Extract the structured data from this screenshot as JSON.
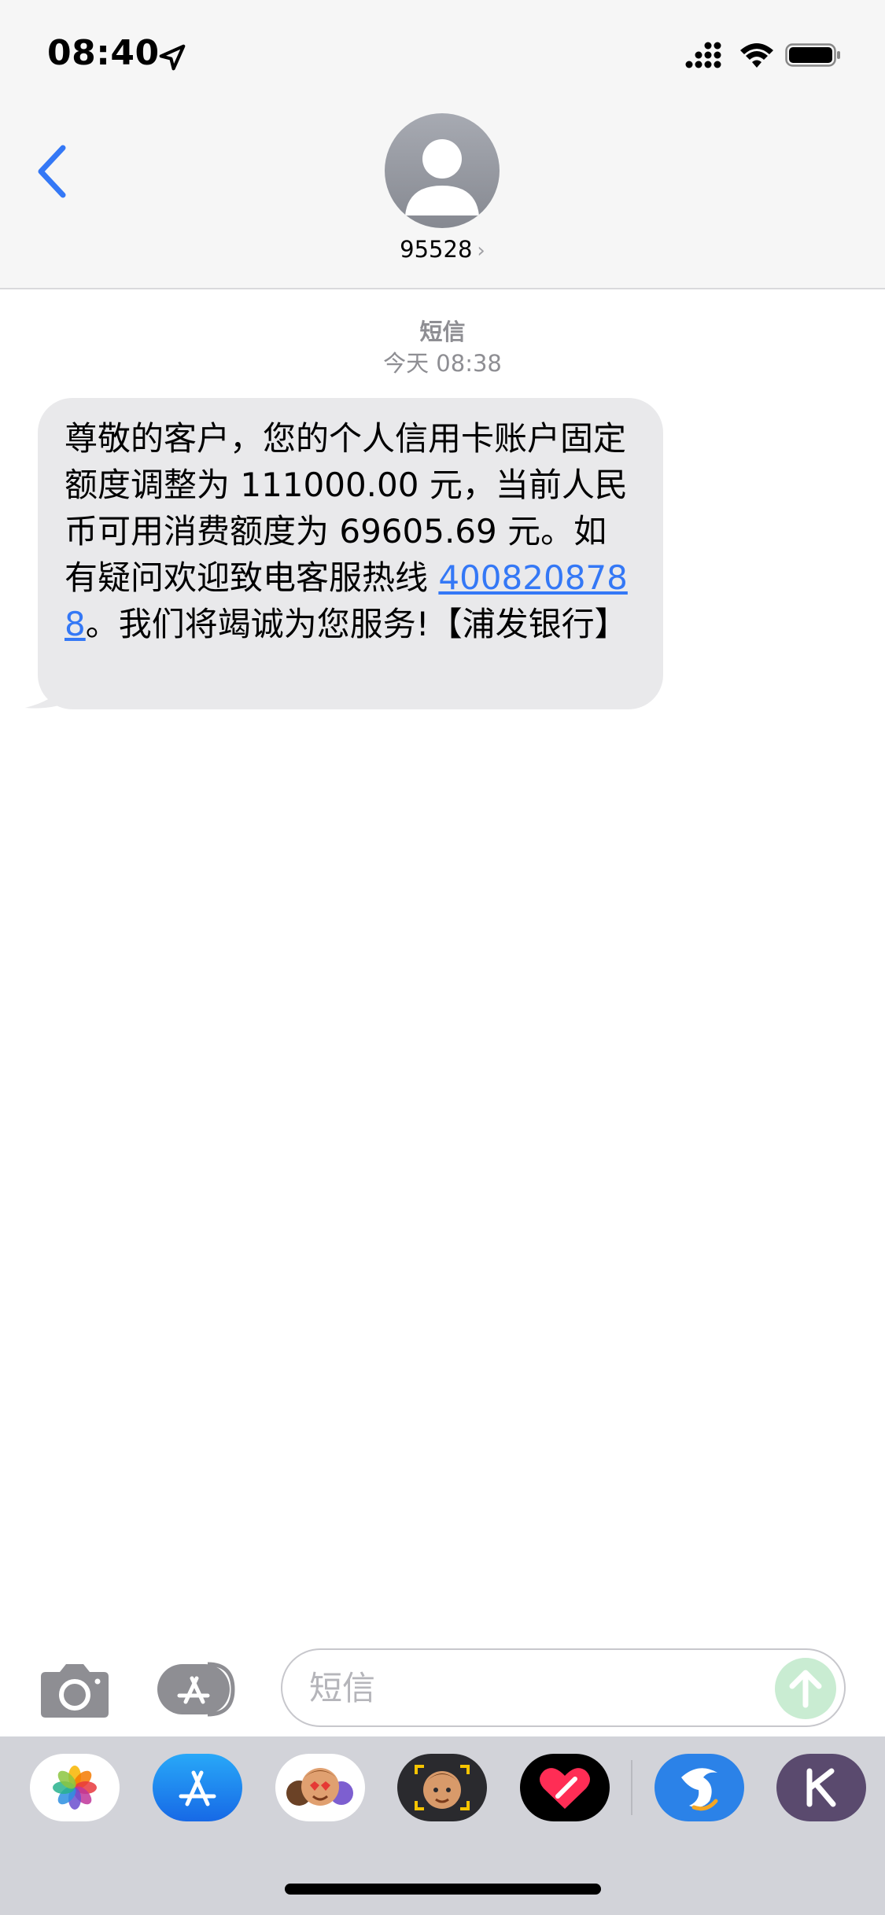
{
  "status_bar": {
    "time": "08:40"
  },
  "header": {
    "contact_name": "95528",
    "chevron": "›"
  },
  "conversation": {
    "service_label": "短信",
    "timestamp": "今天 08:38",
    "message": {
      "text_before_link": "尊敬的客户，您的个人信用卡账户固定额度调整为 111000.00 元，当前人民币可用消费额度为 69605.69 元。如有疑问欢迎致电客服热线 ",
      "link_text": "4008208788",
      "text_after_link": "。我们将竭诚为您服务!【浦发银行】"
    }
  },
  "input_bar": {
    "placeholder": "短信"
  },
  "app_drawer": {
    "apps": [
      "photos-icon",
      "app-store-icon",
      "memoji-stickers-icon",
      "memoji-camera-icon",
      "digital-touch-icon",
      "ctrip-icon",
      "k-app-icon"
    ]
  },
  "colors": {
    "link": "#3478f6",
    "bubble_received": "#e9e9eb",
    "header_bg": "#f6f6f6",
    "drawer_bg": "#d2d3d9",
    "send_button": "#c9ecd2",
    "back_chevron": "#3478f6"
  }
}
